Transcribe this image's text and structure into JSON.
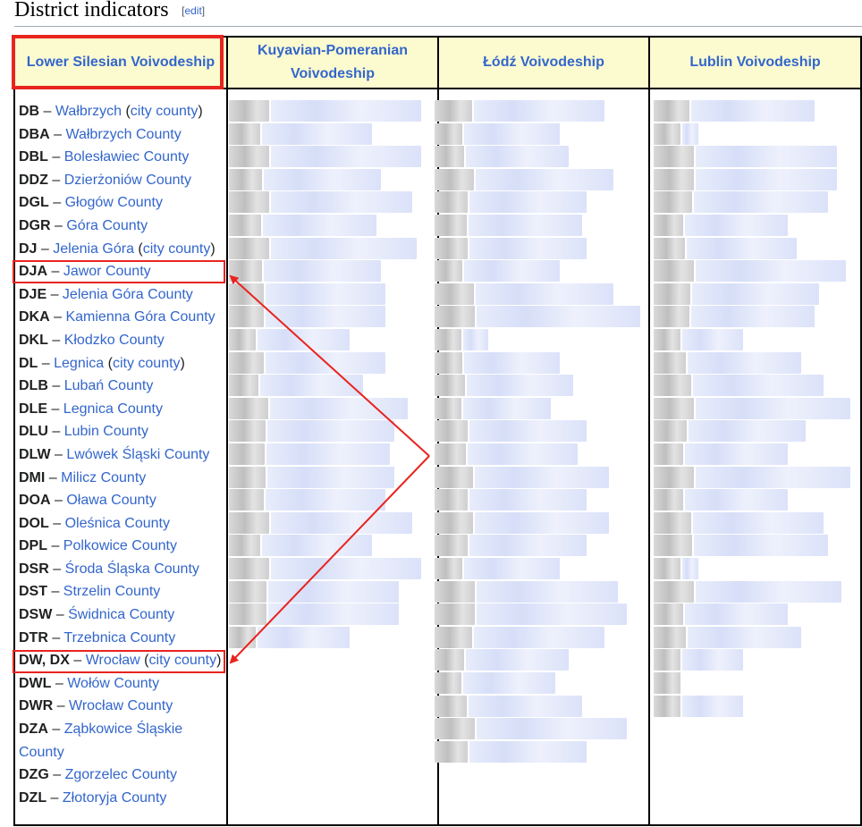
{
  "section": {
    "title": "District indicators",
    "edit_open": "[",
    "edit_label": "edit",
    "edit_close": "]"
  },
  "columns": [
    "Lower Silesian Voivodeship",
    "Kuyavian-Pomeranian Voivodeship",
    "Łódź Voivodeship",
    "Lublin Voivodeship"
  ],
  "lower_silesian": [
    {
      "code": "DB",
      "name": "Wałbrzych",
      "suffix": "city county"
    },
    {
      "code": "DBA",
      "name": "Wałbrzych County"
    },
    {
      "code": "DBL",
      "name": "Bolesławiec County"
    },
    {
      "code": "DDZ",
      "name": "Dzierżoniów County"
    },
    {
      "code": "DGL",
      "name": "Głogów County"
    },
    {
      "code": "DGR",
      "name": "Góra County"
    },
    {
      "code": "DJ",
      "name": "Jelenia Góra",
      "suffix": "city county"
    },
    {
      "code": "DJA",
      "name": "Jawor County"
    },
    {
      "code": "DJE",
      "name": "Jelenia Góra County"
    },
    {
      "code": "DKA",
      "name": "Kamienna Góra County"
    },
    {
      "code": "DKL",
      "name": "Kłodzko County"
    },
    {
      "code": "DL",
      "name": "Legnica",
      "suffix": "city county"
    },
    {
      "code": "DLB",
      "name": "Lubań County"
    },
    {
      "code": "DLE",
      "name": "Legnica County"
    },
    {
      "code": "DLU",
      "name": "Lubin County"
    },
    {
      "code": "DLW",
      "name": "Lwówek Śląski County"
    },
    {
      "code": "DMI",
      "name": "Milicz County"
    },
    {
      "code": "DOA",
      "name": "Oława County"
    },
    {
      "code": "DOL",
      "name": "Oleśnica County"
    },
    {
      "code": "DPL",
      "name": "Polkowice County"
    },
    {
      "code": "DSR",
      "name": "Środa Śląska County"
    },
    {
      "code": "DST",
      "name": "Strzelin County"
    },
    {
      "code": "DSW",
      "name": "Świdnica County"
    },
    {
      "code": "DTR",
      "name": "Trzebnica County"
    },
    {
      "code": "DW, DX",
      "name": "Wrocław",
      "suffix": "city county"
    },
    {
      "code": "DWL",
      "name": "Wołów County"
    },
    {
      "code": "DWR",
      "name": "Wrocław County"
    },
    {
      "code": "DZA",
      "name": "Ząbkowice Śląskie County"
    },
    {
      "code": "DZG",
      "name": "Zgorzelec County"
    },
    {
      "code": "DZL",
      "name": "Złotoryja County"
    }
  ],
  "annotation_color": "#e8241f",
  "header_bg": "#fcfbcf",
  "link_color": "#3366cc"
}
